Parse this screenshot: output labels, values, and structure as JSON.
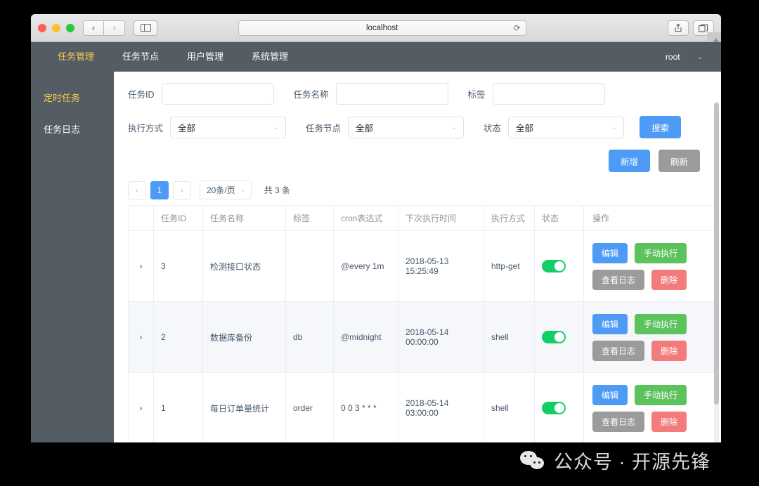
{
  "browser": {
    "url": "localhost",
    "back_label": "‹",
    "forward_label": "›",
    "reload_label": "⟳",
    "share_label": "⬆",
    "tabs_label": "❐",
    "newtab_label": "+"
  },
  "topnav": {
    "items": [
      {
        "label": "任务管理",
        "active": true
      },
      {
        "label": "任务节点",
        "active": false
      },
      {
        "label": "用户管理",
        "active": false
      },
      {
        "label": "系统管理",
        "active": false
      }
    ],
    "user": "root",
    "user_caret": "⌄"
  },
  "sidebar": {
    "items": [
      {
        "label": "定时任务",
        "active": true
      },
      {
        "label": "任务日志",
        "active": false
      }
    ]
  },
  "search_form": {
    "task_id": {
      "label": "任务ID",
      "value": "",
      "placeholder": ""
    },
    "task_name": {
      "label": "任务名称",
      "value": "",
      "placeholder": ""
    },
    "tag": {
      "label": "标签",
      "value": "",
      "placeholder": ""
    },
    "exec_mode": {
      "label": "执行方式",
      "value": "全部",
      "caret": "⌄"
    },
    "task_node": {
      "label": "任务节点",
      "value": "全部",
      "caret": "⌄"
    },
    "status": {
      "label": "状态",
      "value": "全部",
      "caret": "⌄"
    },
    "search_button": "搜索"
  },
  "toolbar": {
    "add_label": "新增",
    "refresh_label": "刷新"
  },
  "pagination": {
    "prev": "‹",
    "next": "›",
    "current_page": "1",
    "page_size": "20条/页",
    "page_size_caret": "⌄",
    "total": "共 3 条"
  },
  "table": {
    "columns": [
      "",
      "任务ID",
      "任务名称",
      "标签",
      "cron表达式",
      "下次执行时间",
      "执行方式",
      "状态",
      "操作"
    ],
    "expand_icon": "›",
    "rows": [
      {
        "id": "3",
        "name": "检测接口状态",
        "tag": "",
        "cron": "@every 1m",
        "next_time": "2018-05-13 15:25:49",
        "exec_mode": "http-get",
        "enabled": true,
        "actions": [
          "编辑",
          "手动执行",
          "查看日志",
          "删除"
        ]
      },
      {
        "id": "2",
        "name": "数据库备份",
        "tag": "db",
        "cron": "@midnight",
        "next_time": "2018-05-14 00:00:00",
        "exec_mode": "shell",
        "enabled": true,
        "actions": [
          "编辑",
          "手动执行",
          "查看日志",
          "删除"
        ]
      },
      {
        "id": "1",
        "name": "每日订单量统计",
        "tag": "order",
        "cron": "0 0 3 * * *",
        "next_time": "2018-05-14 03:00:00",
        "exec_mode": "shell",
        "enabled": true,
        "actions": [
          "编辑",
          "手动执行",
          "查看日志",
          "删除"
        ]
      }
    ]
  },
  "watermark": {
    "text": "公众号 · 开源先锋"
  },
  "colors": {
    "nav_bg": "#545c64",
    "nav_active": "#ffd04b",
    "primary": "#4d9bf5",
    "success": "#5cc25c",
    "danger": "#f47b7b",
    "gray": "#9b9b9b",
    "switch_on": "#13ce66"
  }
}
